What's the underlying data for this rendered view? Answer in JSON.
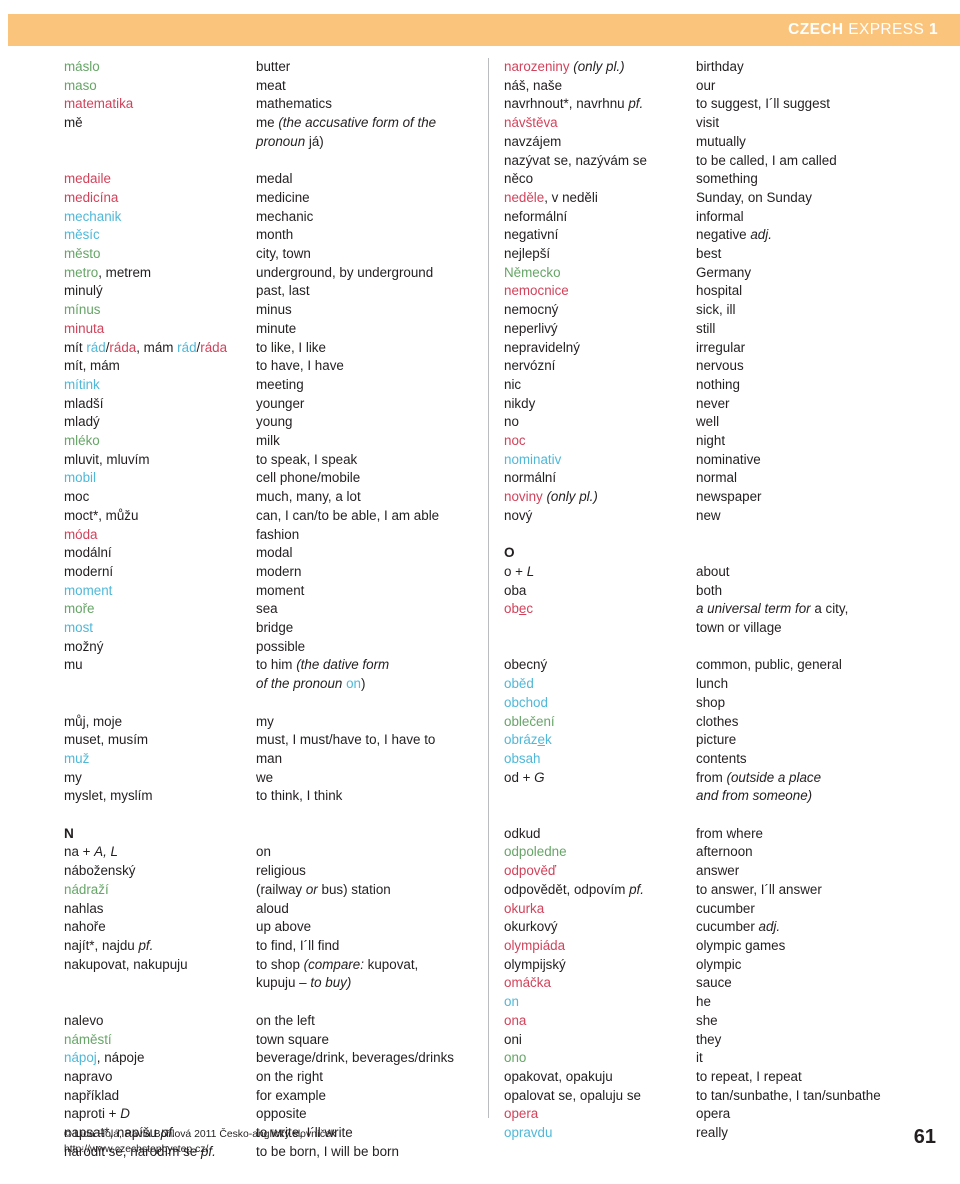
{
  "header": {
    "brand_bold": "CZECH",
    "brand_light": "EXPRESS",
    "brand_number": "1",
    "band_color": "#fbc47c"
  },
  "colors": {
    "green": "#66a567",
    "red": "#d1435b",
    "blue": "#4fb8d8",
    "black": "#231f20",
    "divider": "#b9bdc0"
  },
  "columns": [
    {
      "name": "left-column",
      "entries": [
        {
          "type": "entry",
          "term_html": "<span class=\"c-green\">máslo</span>",
          "gloss_html": "butter"
        },
        {
          "type": "entry",
          "term_html": "<span class=\"c-green\">maso</span>",
          "gloss_html": "meat"
        },
        {
          "type": "entry",
          "term_html": "<span class=\"c-red\">matematika</span>",
          "gloss_html": "mathematics"
        },
        {
          "type": "entry",
          "term_html": "<span class=\"c-black\">mě</span>",
          "gloss_html": "me <span class=\"it\">(the accusative form of the</span><br><span class=\"it\">pronoun</span> já)"
        },
        {
          "type": "spacer"
        },
        {
          "type": "entry",
          "term_html": "<span class=\"c-red\">medaile</span>",
          "gloss_html": "medal"
        },
        {
          "type": "entry",
          "term_html": "<span class=\"c-red\">medicína</span>",
          "gloss_html": "medicine"
        },
        {
          "type": "entry",
          "term_html": "<span class=\"c-blue\">mechanik</span>",
          "gloss_html": "mechanic"
        },
        {
          "type": "entry",
          "term_html": "<span class=\"c-blue\">měsíc</span>",
          "gloss_html": "month"
        },
        {
          "type": "entry",
          "term_html": "<span class=\"c-green\">město</span>",
          "gloss_html": "city, town"
        },
        {
          "type": "entry",
          "term_html": "<span class=\"c-green\">metro</span><span class=\"c-black\">, metrem</span>",
          "gloss_html": "underground, by underground"
        },
        {
          "type": "entry",
          "term_html": "<span class=\"c-black\">minulý</span>",
          "gloss_html": "past, last"
        },
        {
          "type": "entry",
          "term_html": "<span class=\"c-green\">mínus</span>",
          "gloss_html": "minus"
        },
        {
          "type": "entry",
          "term_html": "<span class=\"c-red\">minuta</span>",
          "gloss_html": "minute"
        },
        {
          "type": "entry",
          "term_html": "<span class=\"c-black\">mít </span><span class=\"c-blue\">rád</span><span class=\"c-black\">/</span><span class=\"c-red\">ráda</span><span class=\"c-black\">, mám </span><span class=\"c-blue\">rád</span><span class=\"c-black\">/</span><span class=\"c-red\">ráda</span>",
          "gloss_html": "to like, I like"
        },
        {
          "type": "entry",
          "term_html": "<span class=\"c-black\">mít, mám</span>",
          "gloss_html": "to have, I have"
        },
        {
          "type": "entry",
          "term_html": "<span class=\"c-blue\">mítink</span>",
          "gloss_html": "meeting"
        },
        {
          "type": "entry",
          "term_html": "<span class=\"c-black\">mladší</span>",
          "gloss_html": "younger"
        },
        {
          "type": "entry",
          "term_html": "<span class=\"c-black\">mladý</span>",
          "gloss_html": "young"
        },
        {
          "type": "entry",
          "term_html": "<span class=\"c-green\">mléko</span>",
          "gloss_html": "milk"
        },
        {
          "type": "entry",
          "term_html": "<span class=\"c-black\">mluvit, mluvím</span>",
          "gloss_html": "to speak, I speak"
        },
        {
          "type": "entry",
          "term_html": "<span class=\"c-blue\">mobil</span>",
          "gloss_html": "cell phone/mobile"
        },
        {
          "type": "entry",
          "term_html": "<span class=\"c-black\">moc</span>",
          "gloss_html": "much, many, a lot"
        },
        {
          "type": "entry",
          "term_html": "<span class=\"c-black\">moct*, můžu</span>",
          "gloss_html": "can, I can/to be able, I am able"
        },
        {
          "type": "entry",
          "term_html": "<span class=\"c-red\">móda</span>",
          "gloss_html": "fashion"
        },
        {
          "type": "entry",
          "term_html": "<span class=\"c-black\">modální</span>",
          "gloss_html": "modal"
        },
        {
          "type": "entry",
          "term_html": "<span class=\"c-black\">moderní</span>",
          "gloss_html": "modern"
        },
        {
          "type": "entry",
          "term_html": "<span class=\"c-blue\">moment</span>",
          "gloss_html": "moment"
        },
        {
          "type": "entry",
          "term_html": "<span class=\"c-green\">moře</span>",
          "gloss_html": "sea"
        },
        {
          "type": "entry",
          "term_html": "<span class=\"c-blue\">most</span>",
          "gloss_html": "bridge"
        },
        {
          "type": "entry",
          "term_html": "<span class=\"c-black\">možný</span>",
          "gloss_html": "possible"
        },
        {
          "type": "entry",
          "term_html": "<span class=\"c-black\">mu</span>",
          "gloss_html": "to him <span class=\"it\">(the dative form</span><br><span class=\"it\">of the pronoun</span> <span class=\"c-blue\">on</span>)"
        },
        {
          "type": "spacer"
        },
        {
          "type": "entry",
          "term_html": "<span class=\"c-black\">můj, moje</span>",
          "gloss_html": "my"
        },
        {
          "type": "entry",
          "term_html": "<span class=\"c-black\">muset, musím</span>",
          "gloss_html": "must, I must/have to, I have to"
        },
        {
          "type": "entry",
          "term_html": "<span class=\"c-blue\">muž</span>",
          "gloss_html": "man"
        },
        {
          "type": "entry",
          "term_html": "<span class=\"c-black\">my</span>",
          "gloss_html": "we"
        },
        {
          "type": "entry",
          "term_html": "<span class=\"c-black\">myslet, myslím</span>",
          "gloss_html": "to think, I think"
        },
        {
          "type": "spacer"
        },
        {
          "type": "section",
          "letter": "N"
        },
        {
          "type": "entry",
          "term_html": "<span class=\"c-black\">na + <span class=\"it\">A, L</span></span>",
          "gloss_html": "on"
        },
        {
          "type": "entry",
          "term_html": "<span class=\"c-black\">náboženský</span>",
          "gloss_html": "religious"
        },
        {
          "type": "entry",
          "term_html": "<span class=\"c-green\">nádraží</span>",
          "gloss_html": "(railway <span class=\"it\">or</span> bus) station"
        },
        {
          "type": "entry",
          "term_html": "<span class=\"c-black\">nahlas</span>",
          "gloss_html": "aloud"
        },
        {
          "type": "entry",
          "term_html": "<span class=\"c-black\">nahoře</span>",
          "gloss_html": "up above"
        },
        {
          "type": "entry",
          "term_html": "<span class=\"c-black\">najít*, najdu <span class=\"it\">pf.</span></span>",
          "gloss_html": "to find, I´ll find"
        },
        {
          "type": "entry",
          "term_html": "<span class=\"c-black\">nakupovat, nakupuju</span>",
          "gloss_html": "to shop <span class=\"it\">(compare:</span> kupovat,<br>kupuju – <span class=\"it\">to buy)</span>"
        },
        {
          "type": "spacer"
        },
        {
          "type": "entry",
          "term_html": "<span class=\"c-black\">nalevo</span>",
          "gloss_html": "on the left"
        },
        {
          "type": "entry",
          "term_html": "<span class=\"c-green\">náměstí</span>",
          "gloss_html": "town square"
        },
        {
          "type": "entry",
          "term_html": "<span class=\"c-blue\">nápoj</span><span class=\"c-black\">, nápoje</span>",
          "gloss_html": "beverage/drink, beverages/drinks"
        },
        {
          "type": "entry",
          "term_html": "<span class=\"c-black\">napravo</span>",
          "gloss_html": "on the right"
        },
        {
          "type": "entry",
          "term_html": "<span class=\"c-black\">například</span>",
          "gloss_html": "for example"
        },
        {
          "type": "entry",
          "term_html": "<span class=\"c-black\">naproti + <span class=\"it\">D</span></span>",
          "gloss_html": "opposite"
        },
        {
          "type": "entry",
          "term_html": "<span class=\"c-black\">napsat*, napíšu <span class=\"it\">pf.</span></span>",
          "gloss_html": "to write, I´ll write"
        },
        {
          "type": "entry",
          "term_html": "<span class=\"c-black\">narodit se, narodím se <span class=\"it\">pf.</span></span>",
          "gloss_html": "to be born, I will be born"
        }
      ]
    },
    {
      "name": "right-column",
      "entries": [
        {
          "type": "entry",
          "term_html": "<span class=\"c-red\">narozeniny</span> <span class=\"it\">(only pl.)</span>",
          "gloss_html": "birthday"
        },
        {
          "type": "entry",
          "term_html": "<span class=\"c-black\">náš, naše</span>",
          "gloss_html": "our"
        },
        {
          "type": "entry",
          "term_html": "<span class=\"c-black\">navrhnout*, navrhnu <span class=\"it\">pf.</span></span>",
          "gloss_html": "to suggest, I´ll suggest"
        },
        {
          "type": "entry",
          "term_html": "<span class=\"c-red\">návštěva</span>",
          "gloss_html": "visit"
        },
        {
          "type": "entry",
          "term_html": "<span class=\"c-black\">navzájem</span>",
          "gloss_html": "mutually"
        },
        {
          "type": "entry",
          "term_html": "<span class=\"c-black\">nazývat se, nazývám se</span>",
          "gloss_html": "to be called, I am called"
        },
        {
          "type": "entry",
          "term_html": "<span class=\"c-black\">něco</span>",
          "gloss_html": "something"
        },
        {
          "type": "entry",
          "term_html": "<span class=\"c-red\">neděle</span><span class=\"c-black\">, v neděli</span>",
          "gloss_html": "Sunday, on Sunday"
        },
        {
          "type": "entry",
          "term_html": "<span class=\"c-black\">neformální</span>",
          "gloss_html": "informal"
        },
        {
          "type": "entry",
          "term_html": "<span class=\"c-black\">negativní</span>",
          "gloss_html": "negative <span class=\"it\">adj.</span>"
        },
        {
          "type": "entry",
          "term_html": "<span class=\"c-black\">nejlepší</span>",
          "gloss_html": "best"
        },
        {
          "type": "entry",
          "term_html": "<span class=\"c-green\">Německo</span>",
          "gloss_html": "Germany"
        },
        {
          "type": "entry",
          "term_html": "<span class=\"c-red\">nemocnice</span>",
          "gloss_html": "hospital"
        },
        {
          "type": "entry",
          "term_html": "<span class=\"c-black\">nemocný</span>",
          "gloss_html": "sick, ill"
        },
        {
          "type": "entry",
          "term_html": "<span class=\"c-black\">neperlivý</span>",
          "gloss_html": "still"
        },
        {
          "type": "entry",
          "term_html": "<span class=\"c-black\">nepravidelný</span>",
          "gloss_html": "irregular"
        },
        {
          "type": "entry",
          "term_html": "<span class=\"c-black\">nervózní</span>",
          "gloss_html": "nervous"
        },
        {
          "type": "entry",
          "term_html": "<span class=\"c-black\">nic</span>",
          "gloss_html": "nothing"
        },
        {
          "type": "entry",
          "term_html": "<span class=\"c-black\">nikdy</span>",
          "gloss_html": "never"
        },
        {
          "type": "entry",
          "term_html": "<span class=\"c-black\">no</span>",
          "gloss_html": "well"
        },
        {
          "type": "entry",
          "term_html": "<span class=\"c-red\">noc</span>",
          "gloss_html": "night"
        },
        {
          "type": "entry",
          "term_html": "<span class=\"c-blue\">nominativ</span>",
          "gloss_html": "nominative"
        },
        {
          "type": "entry",
          "term_html": "<span class=\"c-black\">normální</span>",
          "gloss_html": "normal"
        },
        {
          "type": "entry",
          "term_html": "<span class=\"c-red\">noviny</span> <span class=\"it\">(only pl.)</span>",
          "gloss_html": "newspaper"
        },
        {
          "type": "entry",
          "term_html": "<span class=\"c-black\">nový</span>",
          "gloss_html": "new"
        },
        {
          "type": "spacer"
        },
        {
          "type": "section",
          "letter": "O"
        },
        {
          "type": "entry",
          "term_html": "<span class=\"c-black\">o + <span class=\"it\">L</span></span>",
          "gloss_html": "about"
        },
        {
          "type": "entry",
          "term_html": "<span class=\"c-black\">oba</span>",
          "gloss_html": "both"
        },
        {
          "type": "entry",
          "term_html": "<span class=\"c-red\">ob<span class=\"ul\">e</span>c</span>",
          "gloss_html": "<span class=\"it\">a universal term for</span> a city,<br>town or village"
        },
        {
          "type": "spacer"
        },
        {
          "type": "entry",
          "term_html": "<span class=\"c-black\">obecný</span>",
          "gloss_html": "common, public, general"
        },
        {
          "type": "entry",
          "term_html": "<span class=\"c-blue\">oběd</span>",
          "gloss_html": "lunch"
        },
        {
          "type": "entry",
          "term_html": "<span class=\"c-blue\">obchod</span>",
          "gloss_html": "shop"
        },
        {
          "type": "entry",
          "term_html": "<span class=\"c-green\">oblečení</span>",
          "gloss_html": "clothes"
        },
        {
          "type": "entry",
          "term_html": "<span class=\"c-blue\">obráz<span class=\"ul\">e</span>k</span>",
          "gloss_html": "picture"
        },
        {
          "type": "entry",
          "term_html": "<span class=\"c-blue\">obsah</span>",
          "gloss_html": "contents"
        },
        {
          "type": "entry",
          "term_html": "<span class=\"c-black\">od + <span class=\"it\">G</span></span>",
          "gloss_html": "from <span class=\"it\">(outside a place</span><br><span class=\"it\">and from someone)</span>"
        },
        {
          "type": "spacer"
        },
        {
          "type": "entry",
          "term_html": "<span class=\"c-black\">odkud</span>",
          "gloss_html": "from where"
        },
        {
          "type": "entry",
          "term_html": "<span class=\"c-green\">odpoledne</span>",
          "gloss_html": "afternoon"
        },
        {
          "type": "entry",
          "term_html": "<span class=\"c-red\">odpověď</span>",
          "gloss_html": "answer"
        },
        {
          "type": "entry",
          "term_html": "<span class=\"c-black\">odpovědět, odpovím <span class=\"it\">pf.</span></span>",
          "gloss_html": "to answer, I´ll answer"
        },
        {
          "type": "entry",
          "term_html": "<span class=\"c-red\">okurka</span>",
          "gloss_html": "cucumber"
        },
        {
          "type": "entry",
          "term_html": "<span class=\"c-black\">okurkový</span>",
          "gloss_html": "cucumber <span class=\"it\">adj.</span>"
        },
        {
          "type": "entry",
          "term_html": "<span class=\"c-red\">olympiáda</span>",
          "gloss_html": "olympic games"
        },
        {
          "type": "entry",
          "term_html": "<span class=\"c-black\">olympijský</span>",
          "gloss_html": "olympic"
        },
        {
          "type": "entry",
          "term_html": "<span class=\"c-red\">omáčka</span>",
          "gloss_html": "sauce"
        },
        {
          "type": "entry",
          "term_html": "<span class=\"c-blue\">on</span>",
          "gloss_html": "he"
        },
        {
          "type": "entry",
          "term_html": "<span class=\"c-red\">ona</span>",
          "gloss_html": "she"
        },
        {
          "type": "entry",
          "term_html": "<span class=\"c-black\">oni</span>",
          "gloss_html": "they"
        },
        {
          "type": "entry",
          "term_html": "<span class=\"c-green\">ono</span>",
          "gloss_html": "it"
        },
        {
          "type": "entry",
          "term_html": "<span class=\"c-black\">opakovat, opakuju</span>",
          "gloss_html": "to repeat, I repeat"
        },
        {
          "type": "entry",
          "term_html": "<span class=\"c-black\">opalovat se, opaluju se</span>",
          "gloss_html": "to tan/sunbathe, I tan/sunbathe"
        },
        {
          "type": "entry",
          "term_html": "<span class=\"c-red\">opera</span>",
          "gloss_html": "opera"
        },
        {
          "type": "entry",
          "term_html": "<span class=\"c-blue\">opravdu</span>",
          "gloss_html": "really"
        }
      ]
    }
  ],
  "footer": {
    "copyright": "© Lída Holá, Pavla Bořilová 2011 Česko-anglický slovníček",
    "url": "http://www.czechstepbystep.cz/",
    "page_number": "61"
  }
}
